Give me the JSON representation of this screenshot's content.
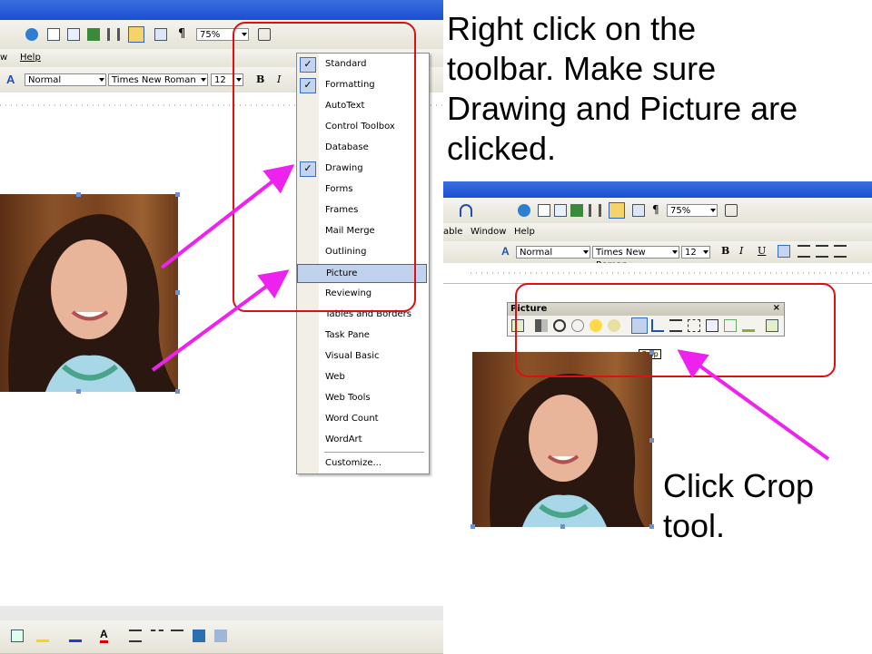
{
  "left_screenshot": {
    "menubar": {
      "items": [
        "w",
        "Help"
      ]
    },
    "toolbar": {
      "zoom": "75%",
      "style": "Normal",
      "font": "Times New Roman",
      "size": "12"
    },
    "context_menu": {
      "items": [
        {
          "label": "Standard",
          "checked": true
        },
        {
          "label": "Formatting",
          "checked": true
        },
        {
          "label": "AutoText",
          "checked": false
        },
        {
          "label": "Control Toolbox",
          "checked": false
        },
        {
          "label": "Database",
          "checked": false
        },
        {
          "label": "Drawing",
          "checked": true
        },
        {
          "label": "Forms",
          "checked": false
        },
        {
          "label": "Frames",
          "checked": false
        },
        {
          "label": "Mail Merge",
          "checked": false
        },
        {
          "label": "Outlining",
          "checked": false
        },
        {
          "label": "Picture",
          "checked": false,
          "highlighted": true
        },
        {
          "label": "Reviewing",
          "checked": false
        },
        {
          "label": "Tables and Borders",
          "checked": false
        },
        {
          "label": "Task Pane",
          "checked": false
        },
        {
          "label": "Visual Basic",
          "checked": false
        },
        {
          "label": "Web",
          "checked": false
        },
        {
          "label": "Web Tools",
          "checked": false
        },
        {
          "label": "Word Count",
          "checked": false
        },
        {
          "label": "WordArt",
          "checked": false
        },
        {
          "label": "Customize...",
          "checked": false
        }
      ]
    }
  },
  "instruction_top": "Right click on the toolbar.  Make sure Drawing and Picture are clicked.",
  "instruction_top_lines": [
    "Right click on the",
    "toolbar.  Make sure",
    "Drawing and Picture are",
    "clicked."
  ],
  "right_screenshot": {
    "menubar": {
      "items": [
        "able",
        "Window",
        "Help"
      ]
    },
    "toolbar": {
      "zoom": "75%",
      "style": "Normal",
      "font": "Times New Roman",
      "size": "12"
    },
    "picture_toolbar": {
      "title": "Picture",
      "tooltip": "Crop"
    }
  },
  "instruction_bottom_lines": [
    "Click Crop",
    "tool."
  ],
  "colors": {
    "annotation_red": "#e01010",
    "arrow_magenta": "#ee22ee",
    "menu_highlight": "#c1d2ee"
  }
}
